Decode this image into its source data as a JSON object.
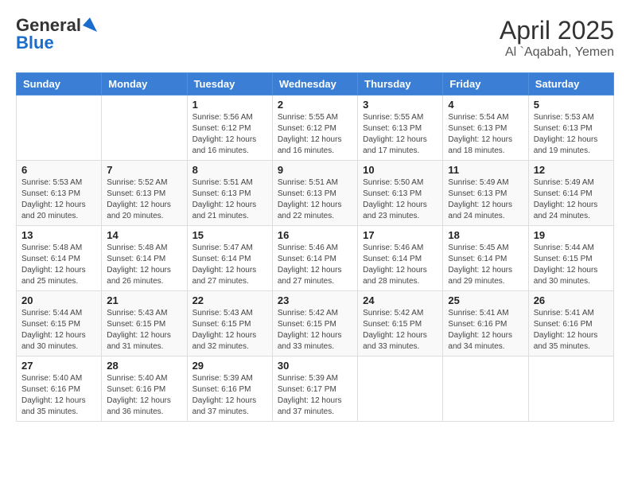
{
  "header": {
    "logo_general": "General",
    "logo_blue": "Blue",
    "title": "April 2025",
    "subtitle": "Al `Aqabah, Yemen"
  },
  "days_of_week": [
    "Sunday",
    "Monday",
    "Tuesday",
    "Wednesday",
    "Thursday",
    "Friday",
    "Saturday"
  ],
  "weeks": [
    [
      {
        "day": "",
        "info": ""
      },
      {
        "day": "",
        "info": ""
      },
      {
        "day": "1",
        "info": "Sunrise: 5:56 AM\nSunset: 6:12 PM\nDaylight: 12 hours and 16 minutes."
      },
      {
        "day": "2",
        "info": "Sunrise: 5:55 AM\nSunset: 6:12 PM\nDaylight: 12 hours and 16 minutes."
      },
      {
        "day": "3",
        "info": "Sunrise: 5:55 AM\nSunset: 6:13 PM\nDaylight: 12 hours and 17 minutes."
      },
      {
        "day": "4",
        "info": "Sunrise: 5:54 AM\nSunset: 6:13 PM\nDaylight: 12 hours and 18 minutes."
      },
      {
        "day": "5",
        "info": "Sunrise: 5:53 AM\nSunset: 6:13 PM\nDaylight: 12 hours and 19 minutes."
      }
    ],
    [
      {
        "day": "6",
        "info": "Sunrise: 5:53 AM\nSunset: 6:13 PM\nDaylight: 12 hours and 20 minutes."
      },
      {
        "day": "7",
        "info": "Sunrise: 5:52 AM\nSunset: 6:13 PM\nDaylight: 12 hours and 20 minutes."
      },
      {
        "day": "8",
        "info": "Sunrise: 5:51 AM\nSunset: 6:13 PM\nDaylight: 12 hours and 21 minutes."
      },
      {
        "day": "9",
        "info": "Sunrise: 5:51 AM\nSunset: 6:13 PM\nDaylight: 12 hours and 22 minutes."
      },
      {
        "day": "10",
        "info": "Sunrise: 5:50 AM\nSunset: 6:13 PM\nDaylight: 12 hours and 23 minutes."
      },
      {
        "day": "11",
        "info": "Sunrise: 5:49 AM\nSunset: 6:13 PM\nDaylight: 12 hours and 24 minutes."
      },
      {
        "day": "12",
        "info": "Sunrise: 5:49 AM\nSunset: 6:14 PM\nDaylight: 12 hours and 24 minutes."
      }
    ],
    [
      {
        "day": "13",
        "info": "Sunrise: 5:48 AM\nSunset: 6:14 PM\nDaylight: 12 hours and 25 minutes."
      },
      {
        "day": "14",
        "info": "Sunrise: 5:48 AM\nSunset: 6:14 PM\nDaylight: 12 hours and 26 minutes."
      },
      {
        "day": "15",
        "info": "Sunrise: 5:47 AM\nSunset: 6:14 PM\nDaylight: 12 hours and 27 minutes."
      },
      {
        "day": "16",
        "info": "Sunrise: 5:46 AM\nSunset: 6:14 PM\nDaylight: 12 hours and 27 minutes."
      },
      {
        "day": "17",
        "info": "Sunrise: 5:46 AM\nSunset: 6:14 PM\nDaylight: 12 hours and 28 minutes."
      },
      {
        "day": "18",
        "info": "Sunrise: 5:45 AM\nSunset: 6:14 PM\nDaylight: 12 hours and 29 minutes."
      },
      {
        "day": "19",
        "info": "Sunrise: 5:44 AM\nSunset: 6:15 PM\nDaylight: 12 hours and 30 minutes."
      }
    ],
    [
      {
        "day": "20",
        "info": "Sunrise: 5:44 AM\nSunset: 6:15 PM\nDaylight: 12 hours and 30 minutes."
      },
      {
        "day": "21",
        "info": "Sunrise: 5:43 AM\nSunset: 6:15 PM\nDaylight: 12 hours and 31 minutes."
      },
      {
        "day": "22",
        "info": "Sunrise: 5:43 AM\nSunset: 6:15 PM\nDaylight: 12 hours and 32 minutes."
      },
      {
        "day": "23",
        "info": "Sunrise: 5:42 AM\nSunset: 6:15 PM\nDaylight: 12 hours and 33 minutes."
      },
      {
        "day": "24",
        "info": "Sunrise: 5:42 AM\nSunset: 6:15 PM\nDaylight: 12 hours and 33 minutes."
      },
      {
        "day": "25",
        "info": "Sunrise: 5:41 AM\nSunset: 6:16 PM\nDaylight: 12 hours and 34 minutes."
      },
      {
        "day": "26",
        "info": "Sunrise: 5:41 AM\nSunset: 6:16 PM\nDaylight: 12 hours and 35 minutes."
      }
    ],
    [
      {
        "day": "27",
        "info": "Sunrise: 5:40 AM\nSunset: 6:16 PM\nDaylight: 12 hours and 35 minutes."
      },
      {
        "day": "28",
        "info": "Sunrise: 5:40 AM\nSunset: 6:16 PM\nDaylight: 12 hours and 36 minutes."
      },
      {
        "day": "29",
        "info": "Sunrise: 5:39 AM\nSunset: 6:16 PM\nDaylight: 12 hours and 37 minutes."
      },
      {
        "day": "30",
        "info": "Sunrise: 5:39 AM\nSunset: 6:17 PM\nDaylight: 12 hours and 37 minutes."
      },
      {
        "day": "",
        "info": ""
      },
      {
        "day": "",
        "info": ""
      },
      {
        "day": "",
        "info": ""
      }
    ]
  ]
}
